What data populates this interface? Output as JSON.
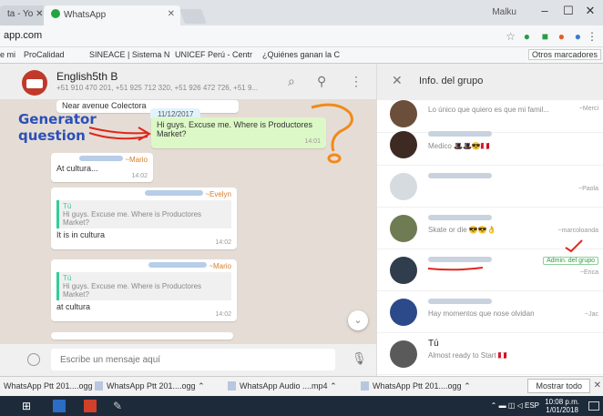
{
  "browser": {
    "tabs": [
      {
        "label": "ta - Yo ✕ /"
      },
      {
        "label": "WhatsApp"
      }
    ],
    "window_user": "Malku",
    "url": "app.com",
    "bookmarks": [
      "ProCalidad",
      "SINEACE | Sistema N",
      "UNICEF Perú - Centr",
      "¿Quiénes ganan la C"
    ],
    "other_bookmarks": "Otros marcadores"
  },
  "chat": {
    "group_name": "English5th B",
    "members_line": "+51 910 470 201, +51 925 712 320, +51 926 472 726, +51 9...",
    "date_chip": "11/12/2017",
    "first_message": "Near avenue Colectora",
    "question_message": "Hi guys. Excuse me. Where is Productores Market?",
    "question_time": "14:01",
    "annotation": {
      "line1": "Generator",
      "line2": "question"
    },
    "messages": [
      {
        "sender": "~Mario",
        "text": "At cultura...",
        "time": "14:02"
      },
      {
        "sender": "~Evelyn",
        "quote_who": "Tú",
        "quote_text": "Hi guys. Excuse me. Where is Productores Market?",
        "text": "It is in cultura",
        "time": "14:02"
      },
      {
        "sender": "~Mario",
        "quote_who": "Tú",
        "quote_text": "Hi guys. Excuse me. Where is Productores Market?",
        "text": "at cultura",
        "time": "14:02"
      }
    ],
    "compose_placeholder": "Escribe un mensaje aquí"
  },
  "info": {
    "title": "Info. del grupo",
    "members": [
      {
        "status": "Lo único que quiero es que mi famil...",
        "side": "~Merci"
      },
      {
        "status": "Medico 🎩🎩😎🇵🇪",
        "side": ""
      },
      {
        "status": "",
        "side": "~Paola"
      },
      {
        "status": "Skate or die 😎😎👌",
        "side": "~marcoloanda"
      },
      {
        "status": "",
        "side": "~Erica",
        "badge": "Admin. del grupo"
      },
      {
        "status": "Hay momentos que nose olvidan",
        "side": "~Jac"
      },
      {
        "name": "Tú",
        "status": "Almost ready to Start 🇵🇪",
        "side": ""
      }
    ]
  },
  "downloads": {
    "items": [
      "WhatsApp Ptt 201....ogg",
      "WhatsApp Ptt 201....ogg",
      "WhatsApp Audio ....mp4",
      "WhatsApp Ptt 201....ogg"
    ],
    "show_all": "Mostrar todo"
  },
  "taskbar": {
    "lang": "ESP",
    "time": "10:08 p.m.",
    "date": "1/01/2018"
  }
}
